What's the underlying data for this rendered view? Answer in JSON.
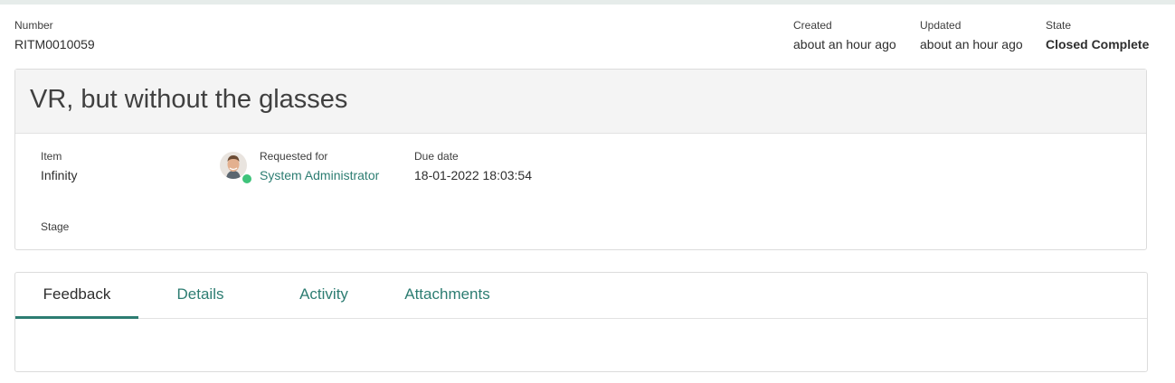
{
  "header": {
    "number_label": "Number",
    "number_value": "RITM0010059",
    "created_label": "Created",
    "created_value": "about an hour ago",
    "updated_label": "Updated",
    "updated_value": "about an hour ago",
    "state_label": "State",
    "state_value": "Closed Complete"
  },
  "card": {
    "title": "VR, but without the glasses",
    "item_label": "Item",
    "item_value": "Infinity",
    "requested_for_label": "Requested for",
    "requested_for_value": "System Administrator",
    "due_date_label": "Due date",
    "due_date_value": "18-01-2022 18:03:54",
    "stage_label": "Stage"
  },
  "tabs": [
    {
      "label": "Feedback",
      "active": true
    },
    {
      "label": "Details",
      "active": false
    },
    {
      "label": "Activity",
      "active": false
    },
    {
      "label": "Attachments",
      "active": false
    }
  ],
  "colors": {
    "accent": "#2d7d72",
    "presence": "#3ec37a"
  }
}
